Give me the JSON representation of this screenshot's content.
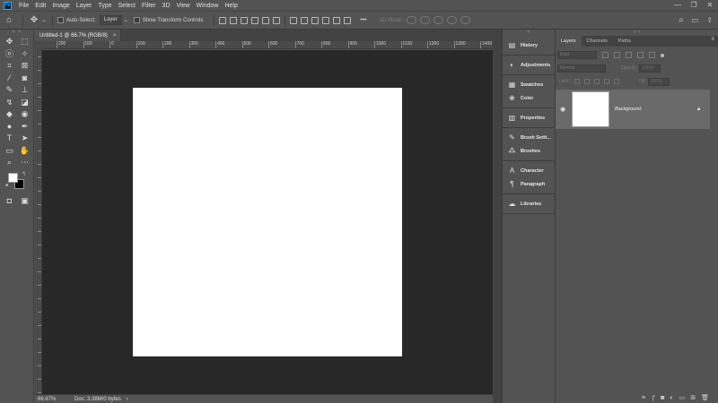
{
  "app": {
    "logo_text": "Ps"
  },
  "menu": [
    "File",
    "Edit",
    "Image",
    "Layer",
    "Type",
    "Select",
    "Filter",
    "3D",
    "View",
    "Window",
    "Help"
  ],
  "window_controls": {
    "minimize": "—",
    "restore": "❐",
    "close": "✕"
  },
  "options_bar": {
    "auto_select_label": "Auto-Select:",
    "auto_select_target": "Layer",
    "show_transform_label": "Show Transform Controls",
    "more_label": "•••",
    "mode_label": "3D Mode:"
  },
  "document": {
    "tab_title": "Untitled-1 @ 66.7% (RGB/8)",
    "tab_close": "×",
    "zoom": "66.67%",
    "doc_info": "Doc: 3.38M/0 bytes"
  },
  "rulers": {
    "top_labels": [
      "200",
      "100",
      "0",
      "100",
      "200",
      "300",
      "400",
      "500",
      "600",
      "700",
      "800",
      "900",
      "1000",
      "1100",
      "1200",
      "1300",
      "1400"
    ]
  },
  "panels": {
    "collapsed": [
      {
        "group": 1,
        "icon": "history-icon",
        "label": "History"
      },
      {
        "group": 2,
        "icon": "adjustments-icon",
        "label": "Adjustments"
      },
      {
        "group": 3,
        "icon": "swatches-icon",
        "label": "Swatches"
      },
      {
        "group": 3,
        "icon": "color-icon",
        "label": "Color"
      },
      {
        "group": 4,
        "icon": "properties-icon",
        "label": "Properties"
      },
      {
        "group": 5,
        "icon": "brush-settings-icon",
        "label": "Brush Setti..."
      },
      {
        "group": 5,
        "icon": "brushes-icon",
        "label": "Brushes"
      },
      {
        "group": 6,
        "icon": "character-icon",
        "label": "Character"
      },
      {
        "group": 6,
        "icon": "paragraph-icon",
        "label": "Paragraph"
      },
      {
        "group": 7,
        "icon": "libraries-icon",
        "label": "Libraries"
      }
    ]
  },
  "layers_panel": {
    "tabs": [
      "Layers",
      "Channels",
      "Paths"
    ],
    "menu_icon": "≡",
    "kind_placeholder": "Kind",
    "blend_mode": "Normal",
    "opacity_label": "Opacity:",
    "opacity_value": "100%",
    "lock_label": "Lock:",
    "fill_label": "Fill:",
    "fill_value": "100%",
    "layers": [
      {
        "name": "Background",
        "visible": true,
        "locked": true
      }
    ]
  }
}
